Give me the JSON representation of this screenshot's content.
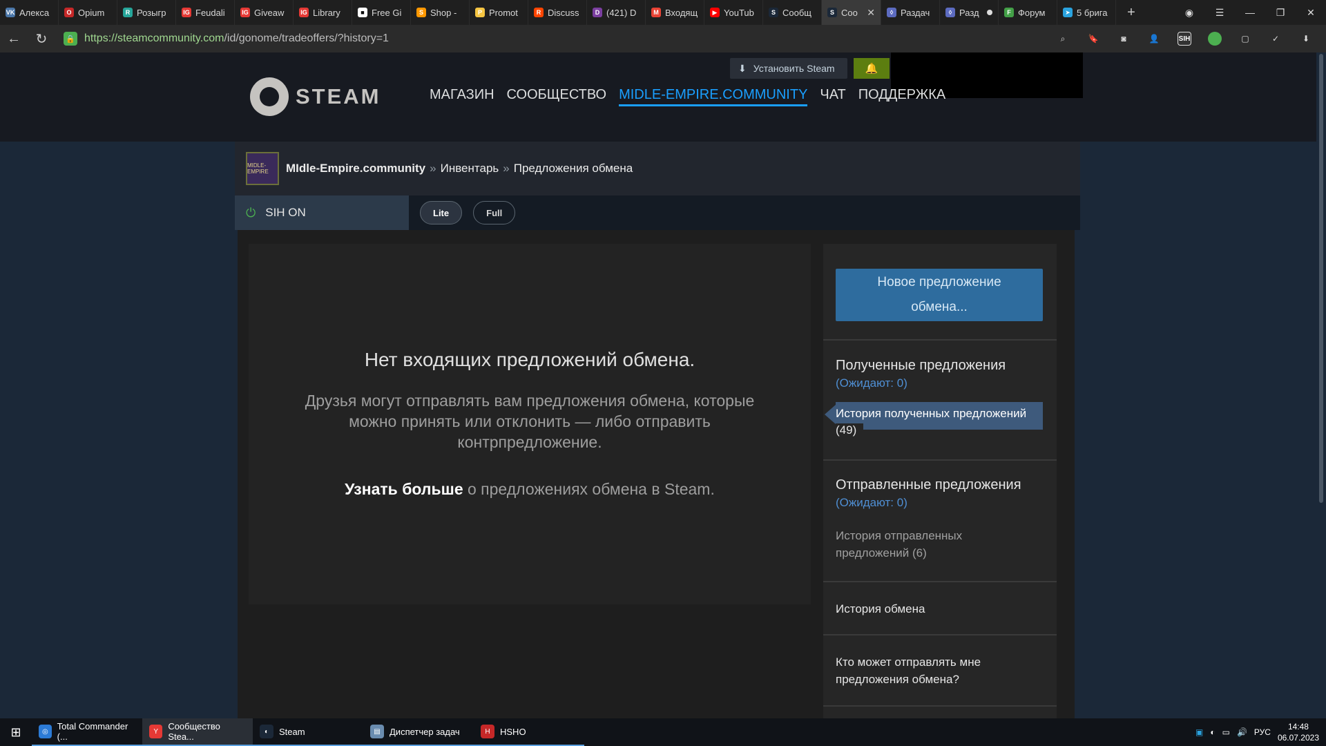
{
  "browser": {
    "tabs": [
      {
        "label": "Алекса",
        "icon": "vk-icon",
        "color": "#4a76a8",
        "glyph": "VK"
      },
      {
        "label": "Opium",
        "icon": "opium-icon",
        "color": "#c62828",
        "glyph": "O"
      },
      {
        "label": "Розыгр",
        "icon": "giveaway-icon",
        "color": "#26a69a",
        "glyph": "R"
      },
      {
        "label": "Feudali",
        "icon": "ig-icon",
        "color": "#e53935",
        "glyph": "IG"
      },
      {
        "label": "Giveaw",
        "icon": "ig-icon",
        "color": "#e53935",
        "glyph": "IG"
      },
      {
        "label": "Library",
        "icon": "ig-icon",
        "color": "#e53935",
        "glyph": "IG"
      },
      {
        "label": "Free Gi",
        "icon": "free-games-icon",
        "color": "#ffffff",
        "glyph": "■"
      },
      {
        "label": "Shop -",
        "icon": "shop-icon",
        "color": "#ff9800",
        "glyph": "S"
      },
      {
        "label": "Promot",
        "icon": "promo-icon",
        "color": "#f5c542",
        "glyph": "P"
      },
      {
        "label": "Discuss",
        "icon": "reddit-icon",
        "color": "#ff4500",
        "glyph": "R"
      },
      {
        "label": "(421) D",
        "icon": "discord-icon",
        "color": "#7b3fa0",
        "glyph": "D"
      },
      {
        "label": "Входящ",
        "icon": "gmail-icon",
        "color": "#ea4335",
        "glyph": "M"
      },
      {
        "label": "YouTub",
        "icon": "youtube-icon",
        "color": "#ff0000",
        "glyph": "▶"
      },
      {
        "label": "Сообщ",
        "icon": "steam-icon",
        "color": "#1b2838",
        "glyph": "S"
      },
      {
        "label": "Coo",
        "icon": "steam-icon",
        "color": "#1b2838",
        "glyph": "S",
        "active": true
      },
      {
        "label": "Раздач",
        "icon": "shield-icon",
        "color": "#5c6bc0",
        "glyph": "◊"
      },
      {
        "label": "Разд",
        "icon": "shield-icon",
        "color": "#5c6bc0",
        "glyph": "◊",
        "dot": true
      },
      {
        "label": "Форум",
        "icon": "forum-icon",
        "color": "#43a047",
        "glyph": "F"
      },
      {
        "label": "5 брига",
        "icon": "telegram-icon",
        "color": "#2aa3df",
        "glyph": "➤"
      }
    ],
    "url_host": "https://steamcommunity.com",
    "url_path": "/id/gonome/tradeoffers/?history=1",
    "extensions": [
      "zoom-icon",
      "bookmark-icon",
      "vr-icon",
      "user-shield-icon",
      "sih-icon",
      "green-ext-icon",
      "ext-icon",
      "ext-check-icon",
      "download-icon"
    ],
    "sih_ext_label": "SIH"
  },
  "steam": {
    "install_label": "Установить Steam",
    "logo_text": "STEAM",
    "nav": [
      "МАГАЗИН",
      "СООБЩЕСТВО",
      "MIDLE-EMPIRE.COMMUNITY",
      "ЧАТ",
      "ПОДДЕРЖКА"
    ],
    "nav_active_index": 2
  },
  "profile": {
    "avatar_text": "MIDLE-EMPIRE",
    "name": "MIdle-Empire.community",
    "sep": "»",
    "crumb1": "Инвентарь",
    "crumb2": "Предложения обмена"
  },
  "sih": {
    "label": "SIH ON",
    "lite": "Lite",
    "full": "Full"
  },
  "main": {
    "empty_title": "Нет входящих предложений обмена.",
    "empty_text": "Друзья могут отправлять вам предложения обмена, которые можно принять или отклонить — либо отправить контрпредложение.",
    "learn_more": "Узнать больше",
    "learn_more_rest": " о предложениях обмена в Steam."
  },
  "sidebar": {
    "new_offer": "Новое предложение обмена...",
    "received_title": "Полученные предложения",
    "received_waiting": "(Ожидают: 0)",
    "received_history": "История полученных предложений",
    "received_history_count": "(49)",
    "sent_title": "Отправленные предложения",
    "sent_waiting": "(Ожидают: 0)",
    "sent_history": "История отправленных предложений (6)",
    "trade_history": "История обмена",
    "who_can_send": "Кто может отправлять мне предложения обмена?"
  },
  "taskbar": {
    "items": [
      {
        "label": "Total Commander (...",
        "icon": "total-commander-icon",
        "color": "#2c7bd6"
      },
      {
        "label": "Сообщество Stea...",
        "icon": "yandex-browser-icon",
        "color": "#e53935",
        "active": true
      },
      {
        "label": "Steam",
        "icon": "steam-icon",
        "color": "#1b2838"
      },
      {
        "label": "Диспетчер задач",
        "icon": "task-manager-icon",
        "color": "#6a8caf"
      },
      {
        "label": "HSHO",
        "icon": "hsho-icon",
        "color": "#c62828"
      }
    ],
    "lang": "РУС",
    "time": "14:48",
    "date": "06.07.2023"
  }
}
